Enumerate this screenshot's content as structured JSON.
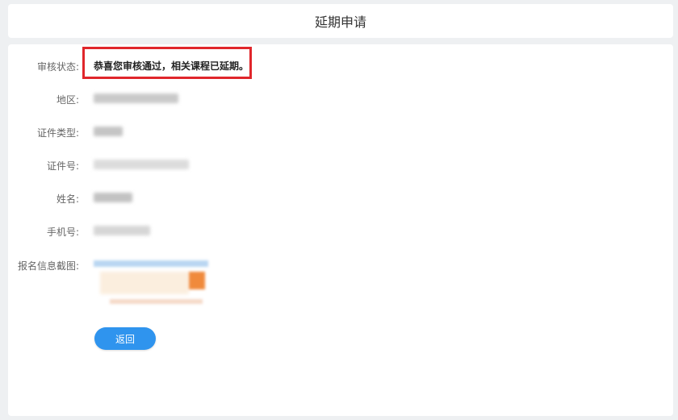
{
  "header": {
    "title": "延期申请"
  },
  "form": {
    "status_label": "审核状态:",
    "status_value": "恭喜您审核通过，相关课程已延期。",
    "region_label": "地区:",
    "id_type_label": "证件类型:",
    "id_number_label": "证件号:",
    "name_label": "姓名:",
    "phone_label": "手机号:",
    "screenshot_label": "报名信息截图:"
  },
  "actions": {
    "back_label": "返回"
  },
  "colors": {
    "accent": "#2f94ee",
    "highlight_border": "#e0262b",
    "background": "#eef0f2"
  }
}
